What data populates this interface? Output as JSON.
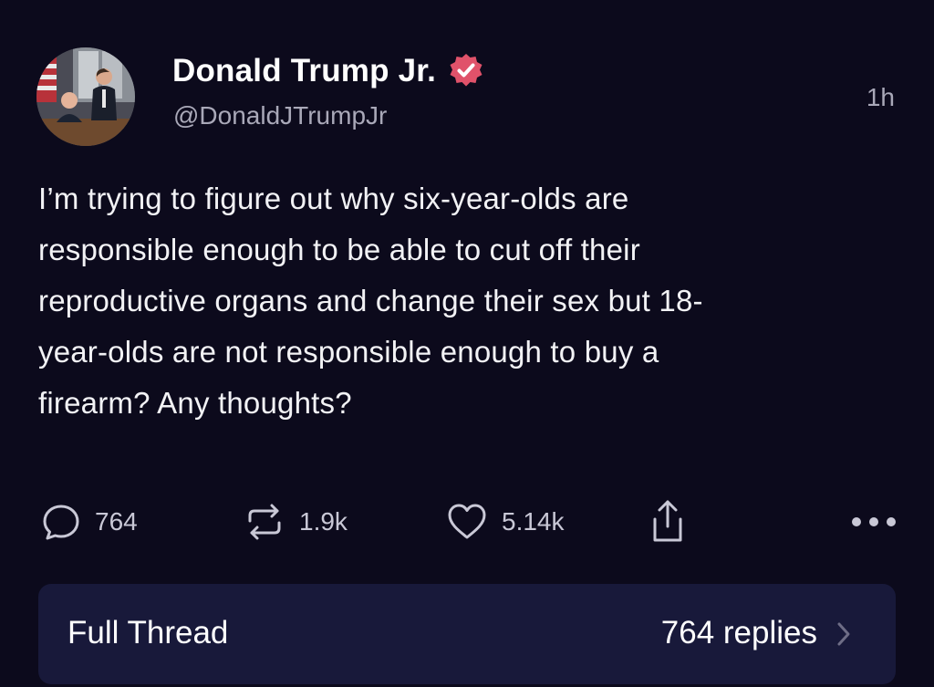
{
  "author": {
    "display_name": "Donald Trump Jr.",
    "handle": "@DonaldJTrumpJr",
    "verified_icon": "verified-badge-icon",
    "avatar": "profile-photo"
  },
  "post": {
    "timestamp": "1h",
    "text_lines": [
      "I’m trying to figure out why six-year-olds are",
      "responsible enough to be able to cut off their",
      "reproductive organs and change their sex but 18-",
      "year-olds are not responsible enough to buy a",
      "firearm? Any thoughts?"
    ]
  },
  "actions": {
    "reply_count": "764",
    "repost_count": "1.9k",
    "like_count": "5.14k",
    "icons": {
      "reply": "speech-bubble-icon",
      "repost": "repost-arrows-icon",
      "like": "heart-icon",
      "share": "share-icon",
      "more": "more-dots-icon"
    }
  },
  "thread": {
    "label": "Full Thread",
    "replies_label": "764 replies",
    "chevron_icon": "chevron-right-icon"
  },
  "colors": {
    "background": "#0c0a1c",
    "muted_text": "#a9a8b8",
    "verified_badge": "#e0526a",
    "thread_bar": "#18193a"
  }
}
